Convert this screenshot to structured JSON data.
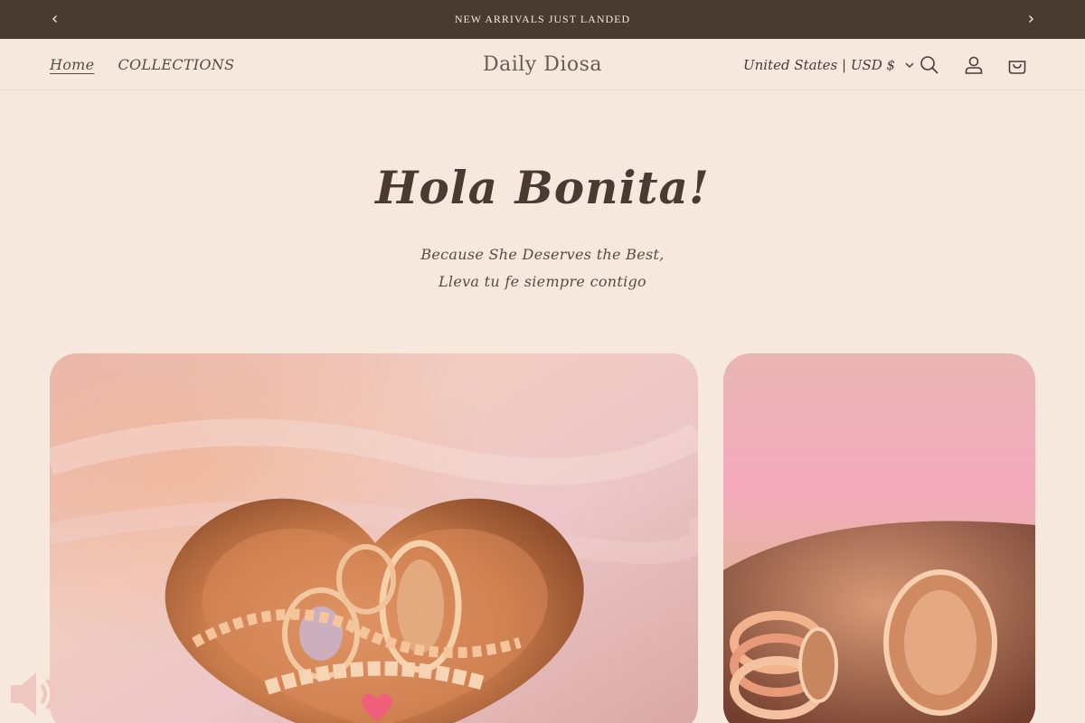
{
  "announcement": {
    "text": "NEW ARRIVALS JUST LANDED",
    "prev_icon": "chevron-left-icon",
    "next_icon": "chevron-right-icon"
  },
  "header": {
    "nav": [
      {
        "label": "Home",
        "active": true
      },
      {
        "label": "COLLECTIONS",
        "active": false
      }
    ],
    "logo": "Daily Diosa",
    "localization": "United States | USD $",
    "icons": [
      "search-icon",
      "account-icon",
      "cart-icon"
    ]
  },
  "hero": {
    "title": "Hola Bonita!",
    "subtitle_line1": "Because She Deserves the Best,",
    "subtitle_line2": "Lleva tu fe siempre contigo"
  },
  "gallery": {
    "images": [
      {
        "name": "heart-dish-jewelry-photo"
      },
      {
        "name": "rings-and-pendant-photo"
      }
    ]
  },
  "widgets": {
    "sound_icon": "speaker-icon",
    "heart_icon": "heart-icon"
  },
  "colors": {
    "background": "#f7e8de",
    "announcement_bar": "#4a3b31",
    "text": "#4a3a32",
    "accent_heart": "#f0607a"
  }
}
